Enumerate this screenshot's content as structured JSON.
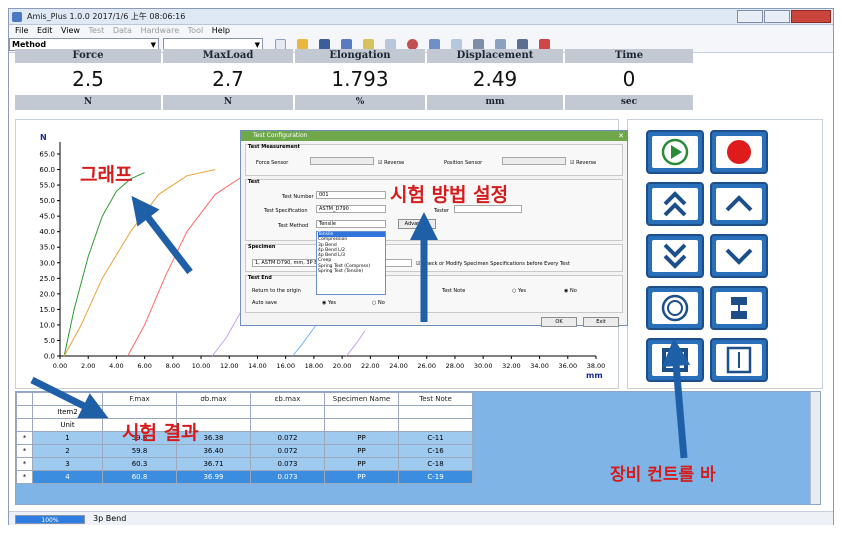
{
  "window": {
    "title": "Amis_Plus 1.0.0 2017/1/6 上午 08:06:16"
  },
  "menu": [
    {
      "label": "File",
      "enabled": true
    },
    {
      "label": "Edit",
      "enabled": true
    },
    {
      "label": "View",
      "enabled": true
    },
    {
      "label": "Test",
      "enabled": false
    },
    {
      "label": "Data",
      "enabled": false
    },
    {
      "label": "Hardware",
      "enabled": false
    },
    {
      "label": "Tool",
      "enabled": false
    },
    {
      "label": "Help",
      "enabled": true
    }
  ],
  "toolbar": {
    "method_value": "Method"
  },
  "readouts": [
    {
      "header": "Force",
      "value": "2.5",
      "unit": "N"
    },
    {
      "header": "MaxLoad",
      "value": "2.7",
      "unit": "N"
    },
    {
      "header": "Elongation",
      "value": "1.793",
      "unit": "%"
    },
    {
      "header": "Displacement",
      "value": "2.49",
      "unit": "mm"
    },
    {
      "header": "Time",
      "value": "0",
      "unit": "sec"
    }
  ],
  "chart_data": {
    "type": "line",
    "ylabel": "N",
    "xlabel": "mm",
    "xlim": [
      0,
      38
    ],
    "ylim": [
      0,
      65
    ],
    "x_ticks": [
      "0.00",
      "2.00",
      "4.00",
      "6.00",
      "8.00",
      "10.00",
      "12.00",
      "14.00",
      "16.00",
      "18.00",
      "20.00",
      "22.00",
      "24.00",
      "26.00",
      "28.00",
      "30.00",
      "32.00",
      "34.00",
      "36.00",
      "38.00"
    ],
    "y_ticks": [
      "0.0",
      "5.0",
      "10.0",
      "15.0",
      "20.0",
      "25.0",
      "30.0",
      "35.0",
      "40.0",
      "45.0",
      "50.0",
      "55.0",
      "60.0",
      "65.0"
    ],
    "series": [
      {
        "color": "#2e9b2e",
        "x": [
          0.3,
          1,
          2,
          3,
          4,
          5,
          6
        ],
        "y": [
          0,
          15,
          32,
          45,
          53,
          57,
          59
        ]
      },
      {
        "color": "#e8a23a",
        "x": [
          0.3,
          1.5,
          3,
          5,
          7,
          9,
          11
        ],
        "y": [
          0,
          10,
          25,
          40,
          52,
          58,
          60
        ]
      },
      {
        "color": "#ff6a6a",
        "x": [
          4.8,
          6,
          7.5,
          9,
          11,
          13,
          15
        ],
        "y": [
          0,
          10,
          26,
          40,
          52,
          58,
          60
        ]
      },
      {
        "color": "#c9a0e8",
        "x": [
          10.8,
          11.8,
          12.8,
          14,
          15.2,
          16.2
        ],
        "y": [
          0,
          6,
          14,
          22,
          30,
          36
        ]
      },
      {
        "color": "#6db4ff",
        "x": [
          16.5,
          17.2,
          18,
          18.8
        ],
        "y": [
          0,
          4,
          9,
          14
        ]
      },
      {
        "color": "#c9a0e8",
        "x": [
          20.3,
          21,
          21.6
        ],
        "y": [
          0,
          4,
          8
        ]
      }
    ],
    "grid": false
  },
  "controls": [
    {
      "name": "start-test-button",
      "icon": "play-icon",
      "color": "#2a8a3a"
    },
    {
      "name": "stop-record-button",
      "icon": "record-icon",
      "color": "#e01b1b"
    },
    {
      "name": "fast-up-button",
      "icon": "double-chevron-up-icon",
      "color": "#1c4f8a"
    },
    {
      "name": "up-button",
      "icon": "chevron-up-icon",
      "color": "#1c4f8a"
    },
    {
      "name": "fast-down-button",
      "icon": "double-chevron-down-icon",
      "color": "#1c4f8a"
    },
    {
      "name": "down-button",
      "icon": "chevron-down-icon",
      "color": "#1c4f8a"
    },
    {
      "name": "reset-button",
      "icon": "circle-reset-icon",
      "color": "#1c4f8a"
    },
    {
      "name": "grip-button",
      "icon": "grip-icon",
      "color": "#1c4f8a"
    },
    {
      "name": "specimen-button",
      "icon": "specimen-icon",
      "color": "#1c4f8a"
    },
    {
      "name": "measure-button",
      "icon": "measure-icon",
      "color": "#1c4f8a"
    }
  ],
  "results": {
    "columns": [
      "",
      "F.max",
      "σb.max",
      "εb.max",
      "Specimen Name",
      "Test Note"
    ],
    "item_row": [
      "Item2",
      "",
      "",
      "",
      "",
      ""
    ],
    "unit_row": [
      "Unit",
      "",
      "",
      "",
      "",
      ""
    ],
    "rows": [
      {
        "marker": "*",
        "cells": [
          "1",
          "59.8",
          "36.38",
          "0.072",
          "PP",
          "C-11"
        ],
        "selected": false
      },
      {
        "marker": "*",
        "cells": [
          "2",
          "59.8",
          "36.40",
          "0.072",
          "PP",
          "C-16"
        ],
        "selected": false
      },
      {
        "marker": "*",
        "cells": [
          "3",
          "60.3",
          "36.71",
          "0.073",
          "PP",
          "C-18"
        ],
        "selected": false
      },
      {
        "marker": "*",
        "cells": [
          "4",
          "60.8",
          "36.99",
          "0.073",
          "PP",
          "C-19"
        ],
        "selected": true
      }
    ]
  },
  "status": {
    "progress": "100%",
    "progress_fraction": 1.0,
    "text": "3p Bend"
  },
  "dialog": {
    "title": "Test Configuration",
    "measurement_section": "Test Measurement",
    "force_sensor_label": "Force Sensor",
    "reverse_label": "Reverse",
    "position_sensor_label": "Position Sensor",
    "test_section": "Test",
    "test_number_label": "Test Number",
    "test_number_value": "001",
    "test_spec_label": "Test Specification",
    "test_spec_value": "ASTM_D790",
    "tester_label": "Tester",
    "test_method_label": "Test Method",
    "test_method_value": "Tensile",
    "advanced_button": "Advanced",
    "method_options": [
      "Tensile",
      "Compression",
      "3p Bend",
      "4p Bend L/2",
      "4p Bend L/3",
      "Creep",
      "Spring Test (Compress)",
      "Spring Test (Tensile)"
    ],
    "specimen_section": "Specimen",
    "specimen_value": "1, ASTM D790, mm, 3P Bend",
    "modify_check": "Check or Modify Specimen Specifications before Every Test",
    "test_end_section": "Test End",
    "return_origin_label": "Return to the origin",
    "auto_save_label": "Auto save",
    "test_note_label": "Test Note",
    "yes": "Yes",
    "no": "No",
    "ok_button": "OK",
    "exit_button": "Exit"
  },
  "annotations": {
    "graph": "그래프",
    "test_method": "시험 방법 설정",
    "result": "시험 결과",
    "control_bar": "장비 컨트롤 바"
  }
}
